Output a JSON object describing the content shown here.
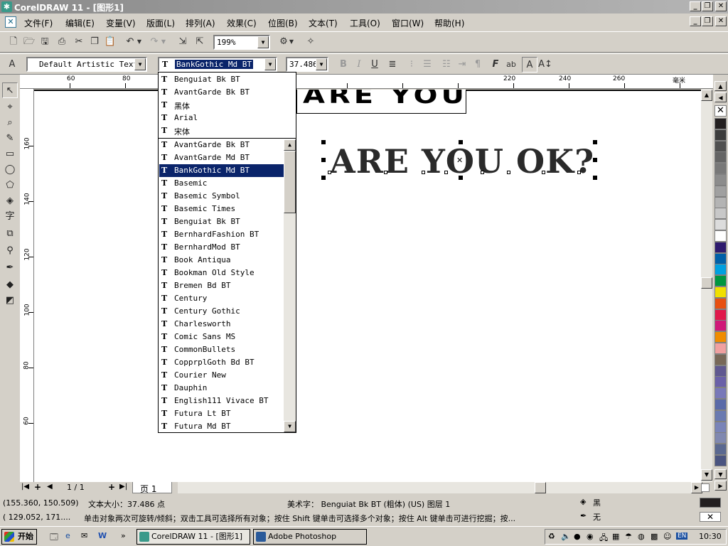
{
  "window": {
    "title": "CorelDRAW 11 - [图形1]",
    "buttons": {
      "minimize": "_",
      "restore": "❐",
      "close": "✕"
    }
  },
  "menu": [
    "文件(F)",
    "编辑(E)",
    "变量(V)",
    "版面(L)",
    "排列(A)",
    "效果(C)",
    "位图(B)",
    "文本(T)",
    "工具(O)",
    "窗口(W)",
    "帮助(H)"
  ],
  "toolbar": {
    "zoom": "199%"
  },
  "property_bar": {
    "style": "Default Artistic Text",
    "font": "BankGothic Md BT",
    "size": "37.486",
    "buttons": [
      "B",
      "I",
      "U"
    ]
  },
  "ruler": {
    "unit": "毫米",
    "h_labels": [
      "60",
      "80",
      "220",
      "240",
      "260"
    ],
    "v_labels": [
      "160",
      "140",
      "120",
      "100",
      "80",
      "60"
    ]
  },
  "canvas": {
    "preview_text": "ARE YOU",
    "artistic_text": "ARE YOU OK?"
  },
  "font_dropdown": {
    "recent": [
      "Benguiat Bk BT",
      "AvantGarde Bk BT",
      "黑体",
      "Arial",
      "宋体"
    ],
    "items": [
      "AvantGarde Bk BT",
      "AvantGarde Md BT",
      "BankGothic Md BT",
      "Basemic",
      "Basemic Symbol",
      "Basemic Times",
      "Benguiat Bk BT",
      "BernhardFashion BT",
      "BernhardMod BT",
      "Book Antiqua",
      "Bookman Old Style",
      "Bremen Bd BT",
      "Century",
      "Century Gothic",
      "Charlesworth",
      "Comic Sans MS",
      "CommonBullets",
      "CopprplGoth Bd BT",
      "Courier New",
      "Dauphin",
      "English111 Vivace BT",
      "Futura Lt BT",
      "Futura Md BT"
    ],
    "selected": "BankGothic Md BT"
  },
  "page_nav": {
    "counter": "1 / 1",
    "tab": "页 1"
  },
  "status": {
    "coords": "(155.360, 150.509)",
    "text_size": "文本大小：37.486 点",
    "object_info": "美术字： Benguiat Bk BT (粗体) (US) 图层 1",
    "fill_label": "黑",
    "outline_label": "无",
    "coords2": "( 129.052, 171....",
    "hint": "单击对象两次可旋转/倾斜；双击工具可选择所有对象；按住 Shift 键单击可选择多个对象；按住 Alt 键单击可进行挖掘；按..."
  },
  "taskbar": {
    "start": "开始",
    "tasks": [
      "CorelDRAW 11 - [图形1]",
      "Adobe Photoshop"
    ],
    "lang": "EN",
    "clock": "10:30"
  },
  "colors": {
    "palette": [
      "#231f20",
      "#3c3c3c",
      "#505050",
      "#646464",
      "#787878",
      "#8c8c8c",
      "#a0a0a0",
      "#b4b4b4",
      "#c8c8c8",
      "#dcdcdc",
      "#ffffff",
      "#2e1a6e",
      "#0060a8",
      "#00a0e0",
      "#009640",
      "#f0e000",
      "#e85010",
      "#e0184a",
      "#d01878",
      "#f08c00",
      "#f0a0a0",
      "#786858",
      "#605890",
      "#6a60a8",
      "#7878b8",
      "#5a6aa8",
      "#6a7ab0",
      "#7a84b8",
      "#8088b0",
      "#5a6890",
      "#4a5480"
    ]
  }
}
